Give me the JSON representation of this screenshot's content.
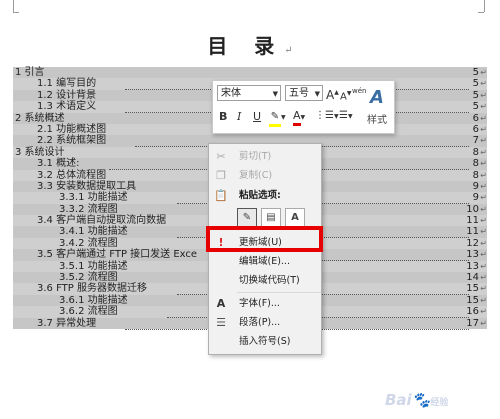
{
  "document": {
    "title": "目 录",
    "paragraph_mark": "↵"
  },
  "toc": [
    {
      "level": 1,
      "text": "1    引言",
      "page": "5",
      "text_w": 55
    },
    {
      "level": 2,
      "text": "1.1 编写目的",
      "page": "5",
      "text_w": 88
    },
    {
      "level": 2,
      "text": "1.2 设计背景",
      "page": "5",
      "text_w": 88
    },
    {
      "level": 2,
      "text": "1.3 术语定义",
      "page": "5",
      "text_w": 88
    },
    {
      "level": 1,
      "text": "2 系统概述",
      "page": "6",
      "text_w": 60
    },
    {
      "level": 2,
      "text": "2.1 功能概述图",
      "page": "6",
      "text_w": 98
    },
    {
      "level": 2,
      "text": "2.2 系统框架图",
      "page": "7",
      "text_w": 98
    },
    {
      "level": 1,
      "text": "3 系统设计",
      "page": "8",
      "text_w": 60
    },
    {
      "level": 2,
      "text": "3.1 概述:",
      "page": "8",
      "text_w": 72
    },
    {
      "level": 2,
      "text": "3.2 总体流程图",
      "page": "8",
      "text_w": 98
    },
    {
      "level": 2,
      "text": "3.3 安装数据提取工具",
      "page": "9",
      "text_w": 128
    },
    {
      "level": 3,
      "text": "3.3.1 功能描述",
      "page": "9",
      "text_w": 118
    },
    {
      "level": 3,
      "text": "3.3.2 流程图",
      "page": "10",
      "text_w": 108
    },
    {
      "level": 2,
      "text": "3.4 客户端自动提取流向数据",
      "page": "11",
      "text_w": 188
    },
    {
      "level": 3,
      "text": "3.4.1 功能描述",
      "page": "11",
      "text_w": 118
    },
    {
      "level": 3,
      "text": "3.4.2 流程图",
      "page": "12",
      "text_w": 108
    },
    {
      "level": 2,
      "text": "3.5 客户端通过 FTP 接口发送 Exce",
      "page": "13",
      "text_w": 202
    },
    {
      "level": 3,
      "text": "3.5.1 功能描述",
      "page": "13",
      "text_w": 118
    },
    {
      "level": 3,
      "text": "3.5.2 流程图",
      "page": "14",
      "text_w": 108
    },
    {
      "level": 2,
      "text": "3.6 FTP 服务器数据迁移",
      "page": "15",
      "text_w": 140
    },
    {
      "level": 3,
      "text": "3.6.1 功能描述",
      "page": "15",
      "text_w": 118
    },
    {
      "level": 3,
      "text": "3.6.2 流程图",
      "page": "16",
      "text_w": 108
    },
    {
      "level": 2,
      "text": "3.7 异常处理",
      "page": "17",
      "text_w": 88
    }
  ],
  "mini_toolbar": {
    "font_name": "宋体",
    "font_size": "五号",
    "grow_font": "A",
    "shrink_font": "A",
    "phonetic": "wén",
    "bold": "B",
    "italic": "I",
    "underline": "U",
    "font_color": "A",
    "styles_label": "样式",
    "styles_icon": "A"
  },
  "context_menu": {
    "cut": "剪切(T)",
    "copy": "复制(C)",
    "paste_options": "粘贴选项:",
    "update_field": "更新域(U)",
    "edit_field": "编辑域(E)...",
    "toggle_field_codes": "切换域代码(T)",
    "font": "字体(F)...",
    "paragraph": "段落(P)...",
    "insert_symbol": "插入符号(S)"
  },
  "watermark": {
    "text": "Bai",
    "suffix": "经验"
  },
  "colors": {
    "highlight_box": "#e60000",
    "toc_shade": "#c6c6c6",
    "styles_accent": "#3a6ea5"
  }
}
